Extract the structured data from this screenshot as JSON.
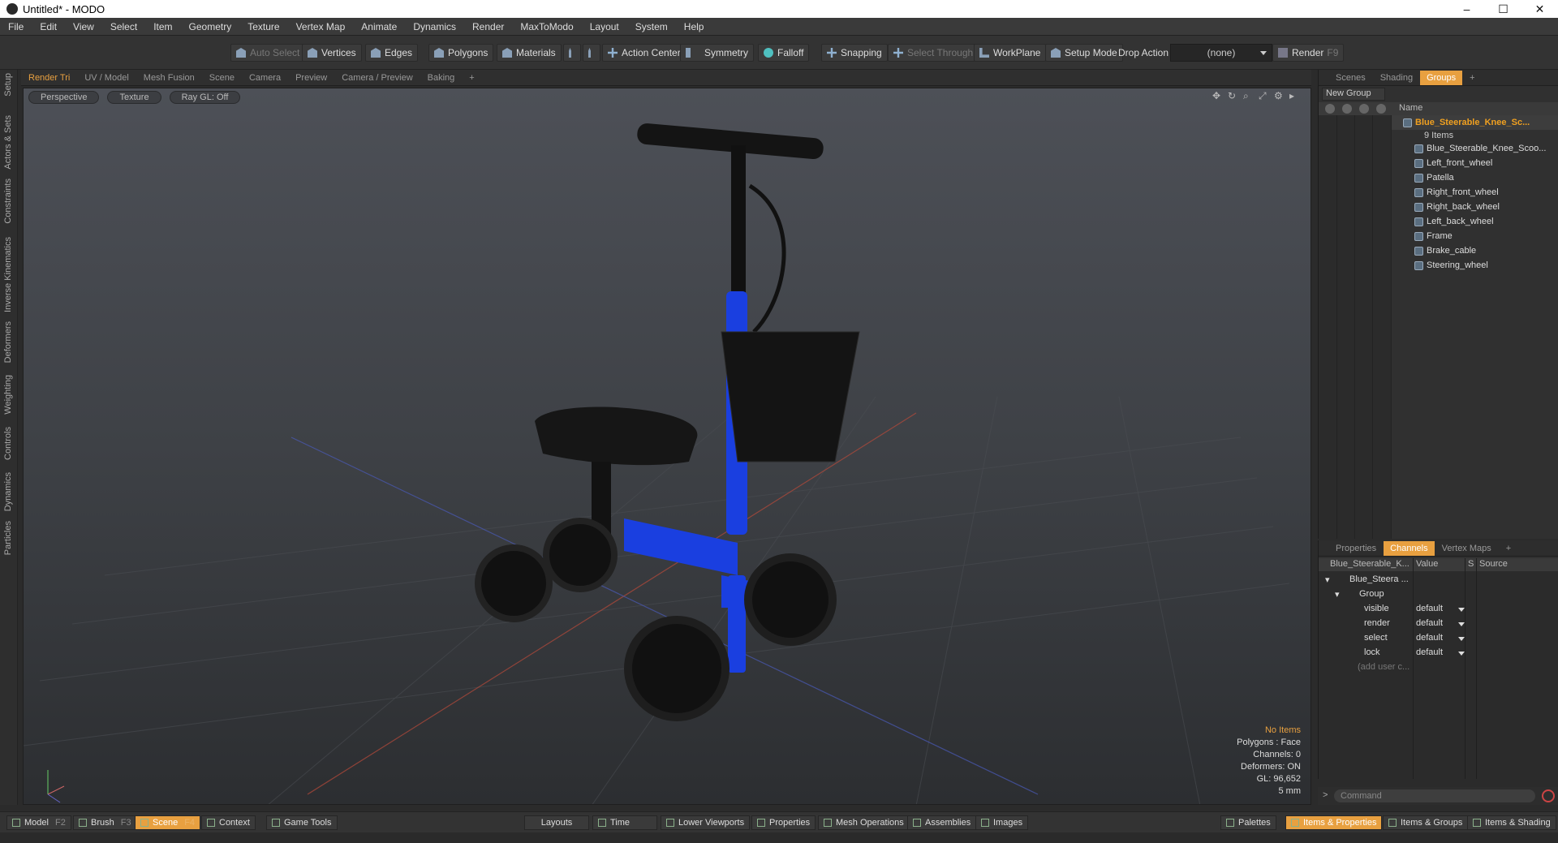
{
  "window": {
    "title": "Untitled* - MODO",
    "minimize": "–",
    "maximize": "☐",
    "close": "✕"
  },
  "menu": [
    "File",
    "Edit",
    "View",
    "Select",
    "Item",
    "Geometry",
    "Texture",
    "Vertex Map",
    "Animate",
    "Dynamics",
    "Render",
    "MaxToModo",
    "Layout",
    "System",
    "Help"
  ],
  "toolbar": {
    "auto_select": "Auto Select",
    "vertices": "Vertices",
    "edges": "Edges",
    "polygons": "Polygons",
    "materials": "Materials",
    "action_center": "Action Center",
    "symmetry": "Symmetry",
    "falloff": "Falloff",
    "snapping": "Snapping",
    "select_through": "Select Through",
    "workplane": "WorkPlane",
    "setup_mode": "Setup Mode",
    "drop_action": "Drop Action",
    "drop_value": "(none)",
    "render": "Render",
    "render_key": "F9"
  },
  "left_tabs": [
    "Setup",
    "Actors & Sets",
    "Constraints",
    "Inverse Kinematics",
    "Deformers",
    "Weighting",
    "Controls",
    "Dynamics",
    "Particles"
  ],
  "viewport_tabs": {
    "items": [
      "Render Tri",
      "UV / Model",
      "Mesh Fusion",
      "Scene",
      "Camera",
      "Preview",
      "Camera / Preview",
      "Baking",
      "+"
    ],
    "active": "Render Tri"
  },
  "viewport": {
    "view": "Perspective",
    "shading": "Texture",
    "raygl": "Ray GL: Off",
    "info": {
      "selection": "No Items",
      "polygons": "Polygons : Face",
      "channels": "Channels: 0",
      "deformers": "Deformers: ON",
      "gl": "GL: 96,652",
      "scale": "5 mm"
    }
  },
  "scene_panel": {
    "tabs": [
      "Scenes",
      "Shading",
      "Groups",
      "+"
    ],
    "active": "Groups",
    "new_group": "New Group",
    "col_name": "Name",
    "root": "Blue_Steerable_Knee_Sc...",
    "count": "9 Items",
    "items": [
      "Blue_Steerable_Knee_Scoo...",
      "Left_front_wheel",
      "Patella",
      "Right_front_wheel",
      "Right_back_wheel",
      "Left_back_wheel",
      "Frame",
      "Brake_cable",
      "Steering_wheel"
    ]
  },
  "channels_panel": {
    "tabs": [
      "Properties",
      "Channels",
      "Vertex Maps",
      "+"
    ],
    "active": "Channels",
    "col_item": "Blue_Steerable_K...",
    "col_value": "Value",
    "col_s": "S",
    "col_source": "Source",
    "root": "Blue_Steera ...",
    "group": "Group",
    "rows": [
      {
        "label": "visible",
        "value": "default"
      },
      {
        "label": "render",
        "value": "default"
      },
      {
        "label": "select",
        "value": "default"
      },
      {
        "label": "lock",
        "value": "default"
      }
    ],
    "add_user": "(add user c..."
  },
  "command": {
    "placeholder": "Command",
    "prompt": ">"
  },
  "bottom": {
    "model": "Model",
    "f2": "F2",
    "brush": "Brush",
    "f3": "F3",
    "scene": "Scene",
    "f4": "F4",
    "context": "Context",
    "game_tools": "Game Tools",
    "layouts": "Layouts",
    "time": "Time",
    "lower_viewports": "Lower Viewports",
    "properties": "Properties",
    "mesh_operations": "Mesh Operations",
    "assemblies": "Assemblies",
    "images": "Images",
    "palettes": "Palettes",
    "items_properties": "Items & Properties",
    "items_groups": "Items & Groups",
    "items_shading": "Items & Shading"
  },
  "colors": {
    "accent": "#e8a040",
    "frame_blue": "#1a3fe0"
  }
}
